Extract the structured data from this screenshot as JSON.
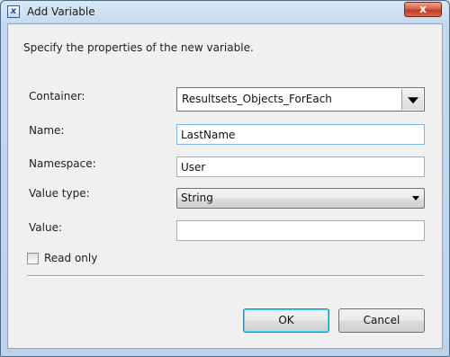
{
  "window": {
    "title": "Add Variable",
    "close_symbol": "x"
  },
  "dialog": {
    "description": "Specify the properties of the new variable.",
    "container": {
      "label": "Container:",
      "value": "Resultsets_Objects_ForEach"
    },
    "name": {
      "label": "Name:",
      "value": "LastName"
    },
    "namespace": {
      "label": "Namespace:",
      "value": "User"
    },
    "value_type": {
      "label": "Value type:",
      "value": "String"
    },
    "value": {
      "label": "Value:",
      "value": ""
    },
    "read_only": {
      "label": "Read only",
      "checked": false
    }
  },
  "buttons": {
    "ok": "OK",
    "cancel": "Cancel"
  },
  "colors": {
    "close_button": "#c33a22",
    "frame": "#c6daef",
    "client_bg": "#f0f0f0",
    "focus_border": "#7eb4ea"
  }
}
